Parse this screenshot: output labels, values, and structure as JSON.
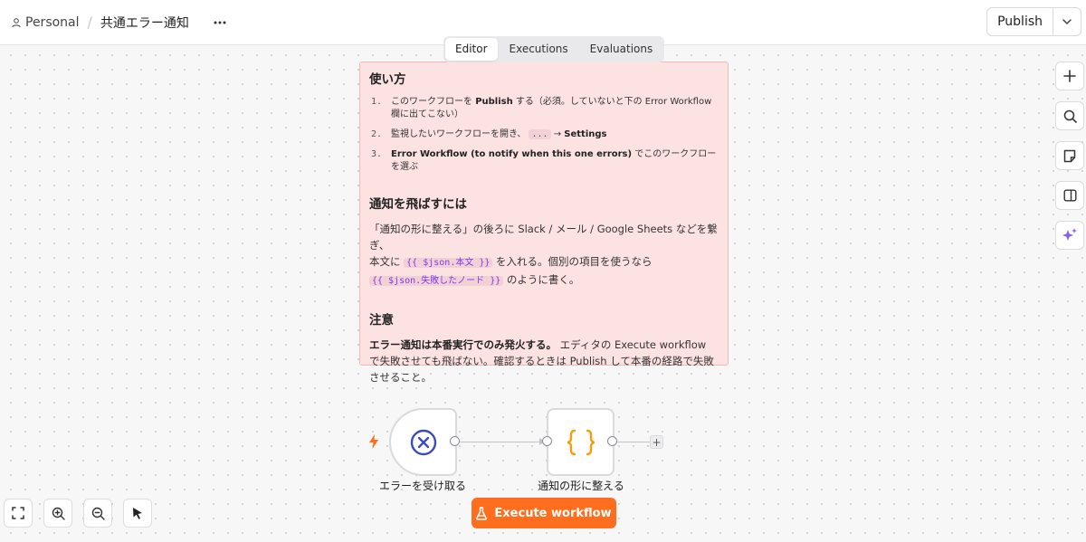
{
  "header": {
    "workspace": "Personal",
    "separator": "/",
    "workflow_name": "共通エラー通知",
    "more_icon": "more-horizontal-icon",
    "publish_label": "Publish",
    "publish_caret_icon": "chevron-down-icon"
  },
  "tabs": [
    {
      "label": "Editor",
      "active": true
    },
    {
      "label": "Executions",
      "active": false
    },
    {
      "label": "Evaluations",
      "active": false
    }
  ],
  "sticky": {
    "h_usage": "使い方",
    "steps": [
      {
        "num": "1.",
        "a": "このワークフローを ",
        "b": "Publish",
        "c": " する（必須。していないと下の Error Workflow 欄に出てこない）"
      },
      {
        "num": "2.",
        "a": "監視したいワークフローを開き、 ",
        "code": "...",
        "arrow": " → ",
        "b": "Settings"
      },
      {
        "num": "3.",
        "b": "Error Workflow (to notify when this one errors)",
        "c": " でこのワークフローを選ぶ"
      }
    ],
    "h_notify": "通知を飛ばすには",
    "notify_line1": "「通知の形に整える」の後ろに Slack / メール / Google Sheets などを繋ぎ、",
    "notify_line2_pre": "本文に ",
    "notify_code1": "{{ $json.本文 }}",
    "notify_line2_post": " を入れる。個別の項目を使うなら",
    "notify_code2": "{{ $json.失敗したノード }}",
    "notify_line3_post": " のように書く。",
    "h_note": "注意",
    "note_bold": "エラー通知は本番実行でのみ発火する。",
    "note_text": " エディタの Execute workflow で失敗させても飛ばない。確認するときは Publish して本番の経路で失敗させること。"
  },
  "nodes": [
    {
      "label": "エラーを受け取る",
      "icon": "error-trigger-x-icon",
      "color": "#3b4cc0"
    },
    {
      "label": "通知の形に整える",
      "icon": "code-braces-icon",
      "color": "#f59e0b"
    }
  ],
  "execute_label": "Execute workflow",
  "execute_icon": "flask-icon",
  "colors": {
    "accent": "#ff6d1f",
    "sticky_bg": "#fde2e2",
    "trigger_blue": "#3b4cc0",
    "code_orange": "#f59e0b"
  },
  "right_tools": [
    "plus-icon",
    "search-icon",
    "sticky-note-icon",
    "panel-toggle-icon",
    "ai-sparkle-icon"
  ],
  "bottom_tools": [
    "fit-view-icon",
    "zoom-in-icon",
    "zoom-out-icon",
    "tidy-up-icon"
  ]
}
